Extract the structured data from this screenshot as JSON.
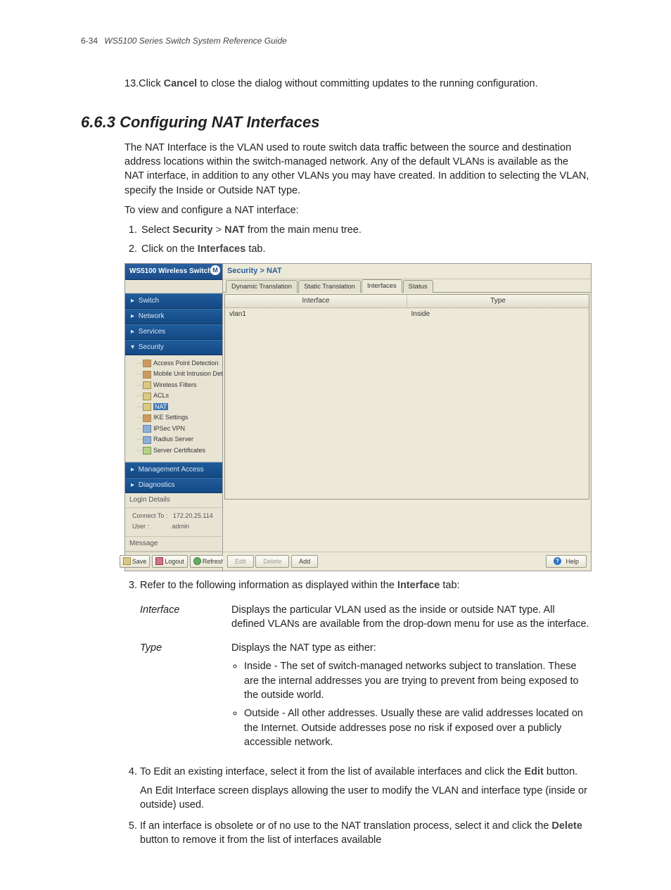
{
  "pageHeader": {
    "num": "6-34",
    "title": "WS5100 Series Switch System Reference Guide"
  },
  "topStep": {
    "num": "13.",
    "pre": "Click ",
    "bold": "Cancel",
    "post": " to close the dialog without committing updates to the running configuration."
  },
  "section": {
    "num": "6.6.3",
    "title": "Configuring NAT Interfaces"
  },
  "intro": "The NAT Interface is the VLAN used to route switch data traffic between the source and destination address locations within the switch-managed network. Any of the default VLANs is available as the NAT interface, in addition to any other VLANs you may have created. In addition to selecting the VLAN, specify the Inside or Outside NAT type.",
  "introLead": "To view and configure a NAT interface:",
  "step1": {
    "pre": "Select ",
    "b1": "Security",
    "mid": " > ",
    "b2": "NAT",
    "post": " from the main menu tree."
  },
  "step2": {
    "pre": "Click on the ",
    "b": "Interfaces",
    "post": " tab."
  },
  "app": {
    "sideTitle": "WS5100 Wireless Switch",
    "logo": "M",
    "nav": [
      "Switch",
      "Network",
      "Services",
      "Security"
    ],
    "navTail": [
      "Management Access",
      "Diagnostics"
    ],
    "tree": [
      "Access Point Detection",
      "Mobile Unit Intrusion Detection",
      "Wireless Filters",
      "ACLs",
      "NAT",
      "IKE Settings",
      "IPSec VPN",
      "Radius Server",
      "Server Certificates"
    ],
    "loginLabel": "Login Details",
    "connectLabel": "Connect To :",
    "connectVal": "172.20.25.114",
    "userLabel": "User :",
    "userVal": "admin",
    "msgLabel": "Message",
    "save": "Save",
    "logout": "Logout",
    "refresh": "Refresh",
    "crumb": "Security > NAT",
    "tabs": [
      "Dynamic Translation",
      "Static Translation",
      "Interfaces",
      "Status"
    ],
    "activeTab": 2,
    "cols": [
      "Interface",
      "Type"
    ],
    "row": [
      "vlan1",
      "Inside"
    ],
    "edit": "Edit",
    "delete": "Delete",
    "add": "Add",
    "help": "Help"
  },
  "step3": {
    "pre": "Refer to the following information as displayed within the ",
    "b": "Interface",
    "post": " tab:"
  },
  "defs": {
    "d1": {
      "term": "Interface",
      "body": "Displays the particular VLAN used as the inside or outside NAT type. All defined VLANs are available from the drop-down menu for use as the interface."
    },
    "d2": {
      "term": "Type",
      "lead": "Displays the NAT type as either:",
      "b1": "Inside - The set of switch-managed networks subject to translation. These are the internal addresses you are trying to prevent from being exposed to the outside world.",
      "b2": "Outside - All other addresses. Usually these are valid addresses located on the Internet. Outside addresses pose no risk if exposed over a publicly accessible network."
    }
  },
  "step4": {
    "pre": "To Edit an existing interface, select it from the list of available interfaces and click the ",
    "b": "Edit",
    "post": " button.",
    "line2": "An Edit Interface screen displays allowing the user to modify the VLAN and interface type (inside or outside) used."
  },
  "step5": {
    "pre": "If an interface is obsolete or of no use to the NAT translation process, select it and click the ",
    "b": "Delete",
    "post": " button to remove it from the list of interfaces available"
  }
}
